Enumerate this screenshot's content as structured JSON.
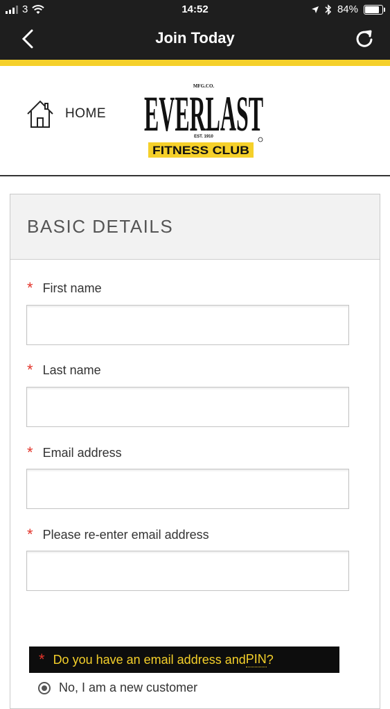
{
  "status_bar": {
    "carrier": "3",
    "time": "14:52",
    "battery": "84%"
  },
  "nav": {
    "title": "Join Today"
  },
  "header": {
    "home_label": "HOME",
    "logo": {
      "mfg": "MFG.CO.",
      "brand": "EVERLAST",
      "est": "EST. 1910",
      "sub": "FITNESS CLUB"
    }
  },
  "form": {
    "section_title": "BASIC DETAILS",
    "required_marker": "*",
    "fields": [
      {
        "label": "First name",
        "value": ""
      },
      {
        "label": "Last name",
        "value": ""
      },
      {
        "label": "Email address",
        "value": ""
      },
      {
        "label": "Please re-enter email address",
        "value": ""
      }
    ],
    "pin_question_prefix": "Do you have an email address and ",
    "pin_word": "PIN",
    "pin_question_suffix": "?",
    "radio_option": "No, I am a new customer"
  },
  "colors": {
    "accent_yellow": "#f5d02a",
    "dark": "#1e1e1e",
    "required_red": "#e3352b"
  }
}
